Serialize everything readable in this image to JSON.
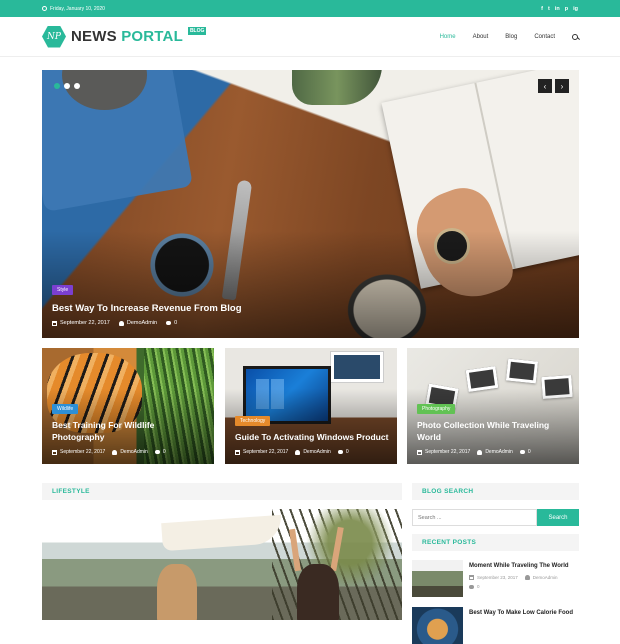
{
  "topbar": {
    "date": "Friday, January 10, 2020",
    "social": [
      "f",
      "t",
      "in",
      "p",
      "ig"
    ]
  },
  "brand": {
    "logo": "NP",
    "name_part1": "NEWS",
    "name_part2": "PORTAL",
    "tag": "BLOG"
  },
  "nav": {
    "items": [
      "Home",
      "About",
      "Blog",
      "Contact"
    ],
    "active": "Home"
  },
  "colors": {
    "accent": "#29b99a",
    "style_tag": "#7b3fd1",
    "wildlife_tag": "#2d8fd5",
    "tech_tag": "#e58a2b",
    "photo_tag": "#62c254"
  },
  "hero": {
    "category": "Style",
    "title": "Best Way To Increase Revenue From Blog",
    "date": "September 22, 2017",
    "author": "DemoAdmin",
    "comments": "0",
    "prev": "‹",
    "next": "›"
  },
  "cards": [
    {
      "category": "Wildlife",
      "title": "Best Training For Wildlife Photography",
      "date": "September 22, 2017",
      "author": "DemoAdmin",
      "comments": "0"
    },
    {
      "category": "Technology",
      "title": "Guide To Activating Windows Product",
      "date": "September 22, 2017",
      "author": "DemoAdmin",
      "comments": "0"
    },
    {
      "category": "Photography",
      "title": "Photo Collection While Traveling World",
      "date": "September 22, 2017",
      "author": "DemoAdmin",
      "comments": "0"
    }
  ],
  "lifestyle": {
    "heading": "LIFESTYLE"
  },
  "sidebar": {
    "search_heading": "BLOG SEARCH",
    "search_placeholder": "Search ...",
    "search_button": "Search",
    "recent_heading": "RECENT POSTS",
    "recent": [
      {
        "title": "Moment While Traveling The World",
        "date": "September 23, 2017",
        "author": "DemoAdmin",
        "comments": "0"
      },
      {
        "title": "Best Way To Make Low Calorie Food"
      }
    ]
  }
}
